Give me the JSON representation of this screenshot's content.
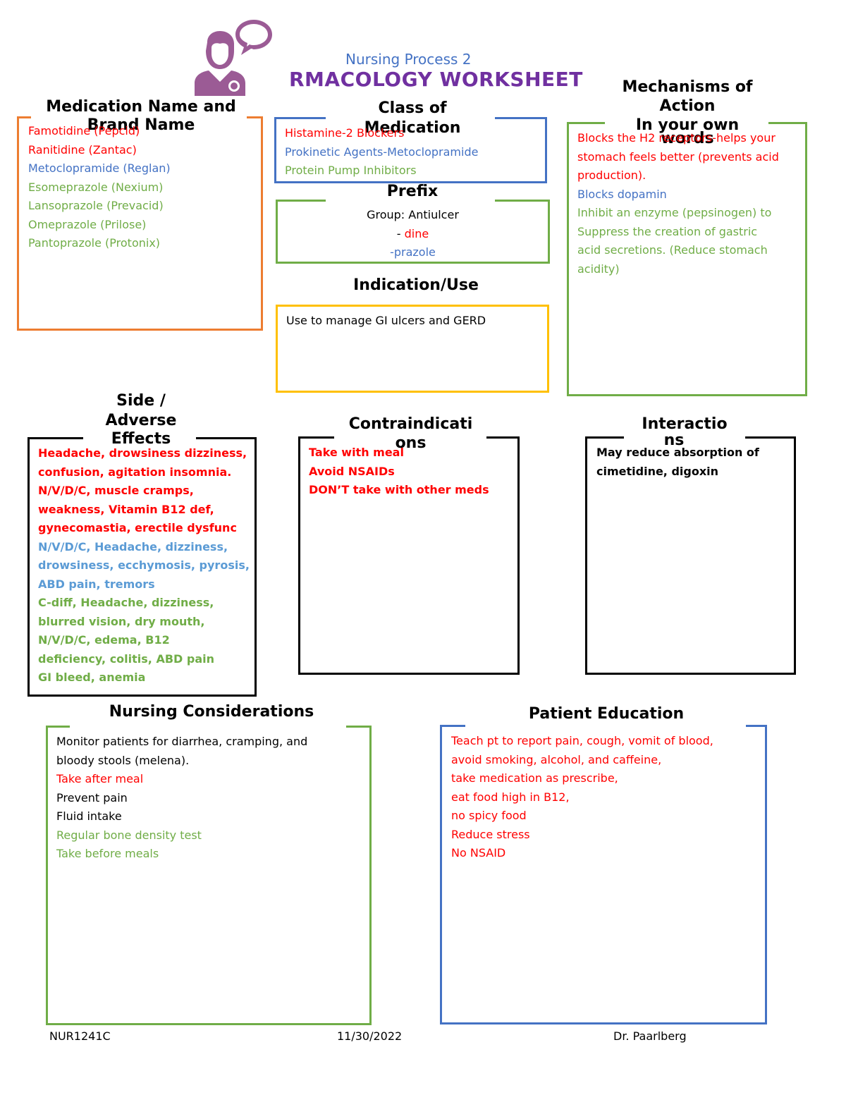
{
  "header": {
    "logo_icon": "nurse-speech-bubble-icon",
    "subtitle": "Nursing Process 2",
    "title": "RMACOLOGY WORKSHEET"
  },
  "colors": {
    "red": "#ff0000",
    "blue": "#4472c4",
    "light_blue": "#5b9bd5",
    "green": "#70ad47",
    "orange": "#ed7d31",
    "yellow": "#ffc000",
    "purple": "#7030a0",
    "logo_purple": "#9b5b95"
  },
  "sections": {
    "medication": {
      "heading_1": "Medication Name and",
      "heading_2": "Brand Name",
      "lines": [
        {
          "text": "Famotidine (Pepcid)",
          "color": "red"
        },
        {
          "text": "Ranitidine (Zantac)",
          "color": "red"
        },
        {
          "text": "Metoclopramide (Reglan)",
          "color": "blue"
        },
        {
          "text": "Esomeprazole (Nexium)",
          "color": "green"
        },
        {
          "text": "Lansoprazole (Prevacid)",
          "color": "green"
        },
        {
          "text": "Omeprazole (Prilose)",
          "color": "green"
        },
        {
          "text": "Pantoprazole (Protonix)",
          "color": "green"
        }
      ]
    },
    "class": {
      "heading_1": "Class of",
      "heading_2": "Medication",
      "lines": [
        {
          "text": "Histamine-2 Blockers",
          "color": "red"
        },
        {
          "text": "Prokinetic Agents-Metoclopramide",
          "color": "blue"
        },
        {
          "text": "Protein Pump Inhibitors",
          "color": "green"
        }
      ]
    },
    "prefix": {
      "heading": "Prefix",
      "group": "Group: Antiulcer",
      "dash": "- ",
      "suffix_1": "dine",
      "suffix_2": "-prazole"
    },
    "indication": {
      "heading": "Indication/Use",
      "text": "Use to manage GI ulcers and GERD"
    },
    "mechanism": {
      "heading_1": "Mechanisms of",
      "heading_2": "Action",
      "heading_3": "In your own",
      "heading_4": "words",
      "lines": [
        {
          "text": "Blocks the H2 receptors-helps your",
          "color": "red"
        },
        {
          "text": "stomach feels better (prevents acid",
          "color": "red"
        },
        {
          "text": "production).",
          "color": "red"
        },
        {
          "text": "Blocks dopamin",
          "color": "blue"
        },
        {
          "text": "Inhibit an enzyme (pepsinogen) to",
          "color": "green"
        },
        {
          "text": "Suppress the creation of gastric",
          "color": "green"
        },
        {
          "text": "acid secretions. (Reduce stomach",
          "color": "green"
        },
        {
          "text": "acidity)",
          "color": "green"
        }
      ]
    },
    "side_effects": {
      "heading_1": "Side /",
      "heading_2": "Adverse",
      "heading_3": "Effects",
      "lines": [
        {
          "text": "Headache, drowsiness dizziness,",
          "color": "red"
        },
        {
          "text": "confusion, agitation insomnia.",
          "color": "red"
        },
        {
          "text": "N/V/D/C, muscle cramps,",
          "color": "red"
        },
        {
          "text": "weakness, Vitamin B12 def,",
          "color": "red"
        },
        {
          "text": "gynecomastia, erectile dysfunc",
          "color": "red"
        },
        {
          "text": "N/V/D/C, Headache, dizziness,",
          "color": "lblue"
        },
        {
          "text": "drowsiness, ecchymosis, pyrosis,",
          "color": "lblue"
        },
        {
          "text": "ABD pain, tremors",
          "color": "lblue"
        },
        {
          "text": "C-diff, Headache, dizziness,",
          "color": "green"
        },
        {
          "text": "blurred vision, dry mouth,",
          "color": "green"
        },
        {
          "text": "N/V/D/C, edema, B12",
          "color": "green"
        },
        {
          "text": "deficiency, colitis, ABD pain",
          "color": "green"
        },
        {
          "text": "GI bleed, anemia",
          "color": "green"
        }
      ]
    },
    "contraindications": {
      "heading_1": "Contraindicati",
      "heading_2": "ons",
      "lines": [
        {
          "text": "Take with meal",
          "color": "red"
        },
        {
          "text": "Avoid NSAIDs",
          "color": "red"
        },
        {
          "text": "DON’T take with other meds",
          "color": "red"
        }
      ]
    },
    "interactions": {
      "heading_1": "Interactio",
      "heading_2": "ns",
      "lines": [
        {
          "text": "May reduce absorption of",
          "color": "black"
        },
        {
          "text": "cimetidine, digoxin",
          "color": "black"
        }
      ]
    },
    "nursing": {
      "heading": "Nursing Considerations",
      "lines": [
        {
          "text": "Monitor patients for diarrhea, cramping, and",
          "color": "black"
        },
        {
          "text": "bloody stools (melena).",
          "color": "black"
        },
        {
          "text": "Take after meal",
          "color": "red"
        },
        {
          "text": "Prevent pain",
          "color": "black"
        },
        {
          "text": "Fluid intake",
          "color": "black"
        },
        {
          "text": "Regular bone density test",
          "color": "green"
        },
        {
          "text": "Take before meals",
          "color": "green"
        }
      ]
    },
    "education": {
      "heading": "Patient Education",
      "lines": [
        {
          "text": "Teach pt to report pain, cough, vomit of blood,",
          "color": "red"
        },
        {
          "text": "avoid smoking, alcohol, and caffeine,",
          "color": "red"
        },
        {
          "text": "take medication as prescribe,",
          "color": "red"
        },
        {
          "text": "eat food high in B12,",
          "color": "red"
        },
        {
          "text": "no spicy food",
          "color": "red"
        },
        {
          "text": "Reduce stress",
          "color": "red"
        },
        {
          "text": "No NSAID",
          "color": "red"
        }
      ]
    }
  },
  "footer": {
    "course": "NUR1241C",
    "date": "11/30/2022",
    "instructor": "Dr. Paarlberg"
  }
}
